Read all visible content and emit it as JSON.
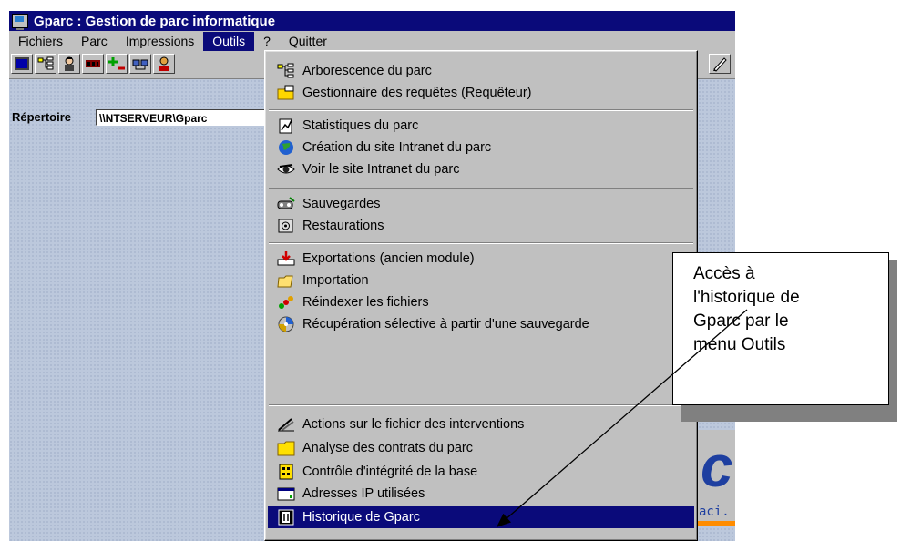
{
  "window": {
    "title": "Gparc : Gestion de parc informatique"
  },
  "menubar": {
    "items": [
      {
        "label": "Fichiers",
        "accel": "F"
      },
      {
        "label": "Parc",
        "accel": "P"
      },
      {
        "label": "Impressions",
        "accel": "I"
      },
      {
        "label": "Outils",
        "accel": "O",
        "active": true
      },
      {
        "label": "?",
        "accel": "?"
      },
      {
        "label": "Quitter",
        "accel": "Q"
      }
    ]
  },
  "toolbar": {
    "buttons": [
      "computer-icon",
      "tree-icon",
      "technician-icon",
      "memory-icon",
      "add-remove-icon",
      "network-icon",
      "user-icon",
      "pen-icon"
    ]
  },
  "content": {
    "directory_label": "Répertoire",
    "directory_value": "\\\\NTSERVEUR\\Gparc",
    "logo_url_fragment": "aci."
  },
  "tools_menu": {
    "items": [
      {
        "label": "Arborescence du parc",
        "icon": "tree-icon",
        "selected": false
      },
      {
        "label": "Gestionnaire des requêtes (Requêteur)",
        "icon": "folder-query-icon",
        "selected": false
      },
      {
        "label": "Statistiques du parc",
        "icon": "statistics-icon",
        "selected": false
      },
      {
        "label": "Création du site Intranet du parc",
        "icon": "globe-icon",
        "selected": false
      },
      {
        "label": "Voir le site Intranet du parc",
        "icon": "eye-icon",
        "selected": false
      },
      {
        "label": "Sauvegardes",
        "icon": "backup-icon",
        "selected": false
      },
      {
        "label": "Restaurations",
        "icon": "restore-icon",
        "selected": false
      },
      {
        "label": "Exportations (ancien module)",
        "icon": "export-icon",
        "selected": false
      },
      {
        "label": "Importation",
        "icon": "import-icon",
        "selected": false
      },
      {
        "label": "Réindexer les fichiers",
        "icon": "reindex-icon",
        "selected": false
      },
      {
        "label": "Récupération sélective à partir d'une sauvegarde",
        "icon": "recovery-icon",
        "selected": false
      },
      {
        "label": "Actions sur le fichier des interventions",
        "icon": "interventions-icon",
        "selected": false
      },
      {
        "label": "Analyse des contrats du parc",
        "icon": "folder-icon",
        "selected": false
      },
      {
        "label": "Contrôle d'intégrité de la base",
        "icon": "integrity-icon",
        "selected": false
      },
      {
        "label": "Adresses IP utilisées",
        "icon": "ip-address-icon",
        "selected": false
      },
      {
        "label": "Historique de Gparc",
        "icon": "history-icon",
        "selected": true
      }
    ]
  },
  "callout": {
    "text": "Accès à l'historique de Gparc par le menu Outils",
    "lines": [
      "Accès à",
      "l'historique de",
      "Gparc par le",
      "menu Outils"
    ]
  },
  "colors": {
    "titlebar": "#0a0a7a",
    "menu_face": "#c0c0c0",
    "selection": "#0a0a7a",
    "workspace": "#bcc8dc"
  }
}
